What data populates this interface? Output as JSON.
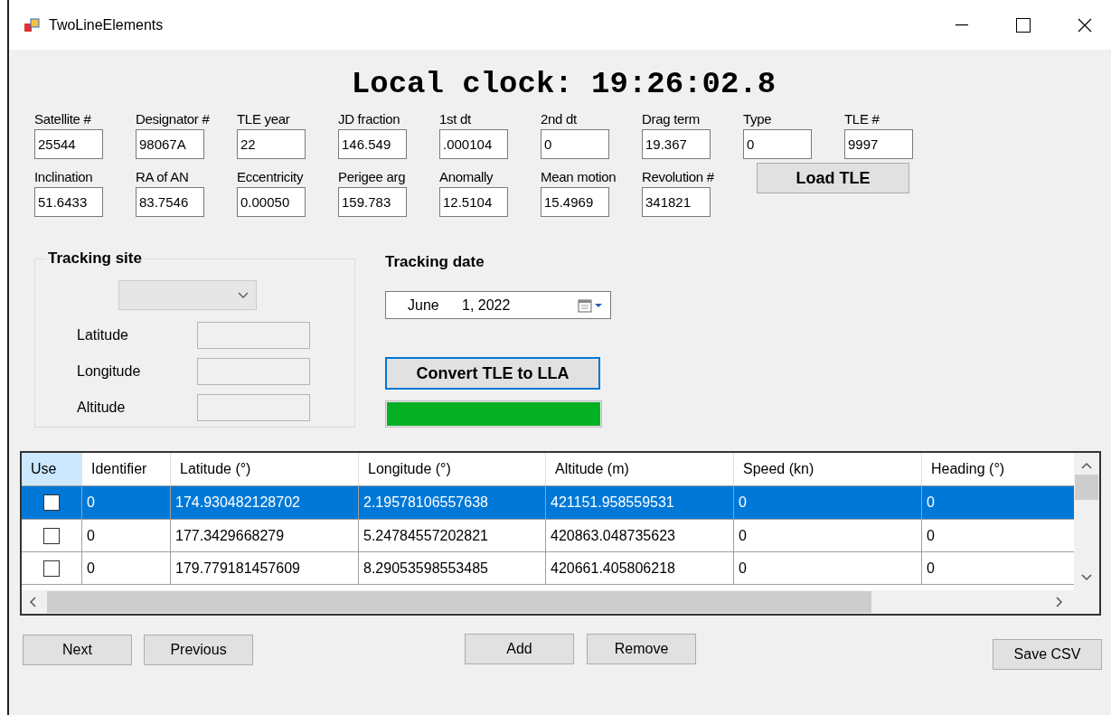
{
  "window": {
    "title": "TwoLineElements"
  },
  "clock": "Local clock: 19:26:02.8",
  "tle_fields_row_1": [
    {
      "label": "Satellite #",
      "value": "25544"
    },
    {
      "label": "Designator #",
      "value": "98067A"
    },
    {
      "label": "TLE year",
      "value": "22"
    },
    {
      "label": "JD fraction",
      "value": "146.549"
    },
    {
      "label": "1st dt",
      "value": ".000104"
    },
    {
      "label": "2nd dt",
      "value": "0"
    },
    {
      "label": "Drag term",
      "value": "19.367"
    },
    {
      "label": "Type",
      "value": "0"
    },
    {
      "label": "TLE #",
      "value": "9997"
    }
  ],
  "tle_fields_row_2": [
    {
      "label": "Inclination",
      "value": "51.6433"
    },
    {
      "label": "RA of AN",
      "value": "83.7546"
    },
    {
      "label": "Eccentricity",
      "value": "0.00050"
    },
    {
      "label": "Perigee arg",
      "value": "159.783"
    },
    {
      "label": "Anomally",
      "value": "12.5104"
    },
    {
      "label": "Mean motion",
      "value": "15.4969"
    },
    {
      "label": "Revolution #",
      "value": "341821"
    }
  ],
  "load_button": "Load TLE",
  "tracking_site": {
    "title": "Tracking site",
    "site_dropdown": {
      "disabled": true
    },
    "fields": [
      {
        "label": "Latitude",
        "disabled": true
      },
      {
        "label": "Longitude",
        "disabled": true
      },
      {
        "label": "Altitude",
        "disabled": true
      }
    ]
  },
  "tracking_date": {
    "title": "Tracking date",
    "month": "June",
    "day_year": "1, 2022"
  },
  "convert_button": "Convert TLE to LLA",
  "progress": {
    "level": 1
  },
  "table": {
    "columns": [
      {
        "label": "Use",
        "selected": true
      },
      {
        "label": "Identifier",
        "selected": false
      },
      {
        "label": "Latitude (°)",
        "selected": false
      },
      {
        "label": "Longitude (°)",
        "selected": false
      },
      {
        "label": "Altitude (m)",
        "selected": false
      },
      {
        "label": "Speed (kn)",
        "selected": false
      },
      {
        "label": "Heading (°)",
        "selected": false
      }
    ],
    "rows": [
      {
        "selected": true,
        "cells": [
          {
            "kind": "checkbox",
            "checked": false
          },
          {
            "kind": "text",
            "text": "0"
          },
          {
            "kind": "text",
            "text": "174.930482128702"
          },
          {
            "kind": "text",
            "text": "2.19578106557638"
          },
          {
            "kind": "text",
            "text": "421151.958559531"
          },
          {
            "kind": "text",
            "text": "0"
          },
          {
            "kind": "text",
            "text": "0"
          }
        ]
      },
      {
        "selected": false,
        "cells": [
          {
            "kind": "checkbox",
            "checked": false
          },
          {
            "kind": "text",
            "text": "0"
          },
          {
            "kind": "text",
            "text": "177.3429668279"
          },
          {
            "kind": "text",
            "text": "5.24784557202821"
          },
          {
            "kind": "text",
            "text": "420863.048735623"
          },
          {
            "kind": "text",
            "text": "0"
          },
          {
            "kind": "text",
            "text": "0"
          }
        ]
      },
      {
        "selected": false,
        "cells": [
          {
            "kind": "checkbox",
            "checked": false
          },
          {
            "kind": "text",
            "text": "0"
          },
          {
            "kind": "text",
            "text": "179.779181457609"
          },
          {
            "kind": "text",
            "text": "8.29053598553485"
          },
          {
            "kind": "text",
            "text": "420661.405806218"
          },
          {
            "kind": "text",
            "text": "0"
          },
          {
            "kind": "text",
            "text": "0"
          }
        ]
      }
    ]
  },
  "nav_buttons": [
    "Next",
    "Previous"
  ],
  "edit_buttons": [
    "Add",
    "Remove"
  ],
  "save_button": "Save CSV"
}
